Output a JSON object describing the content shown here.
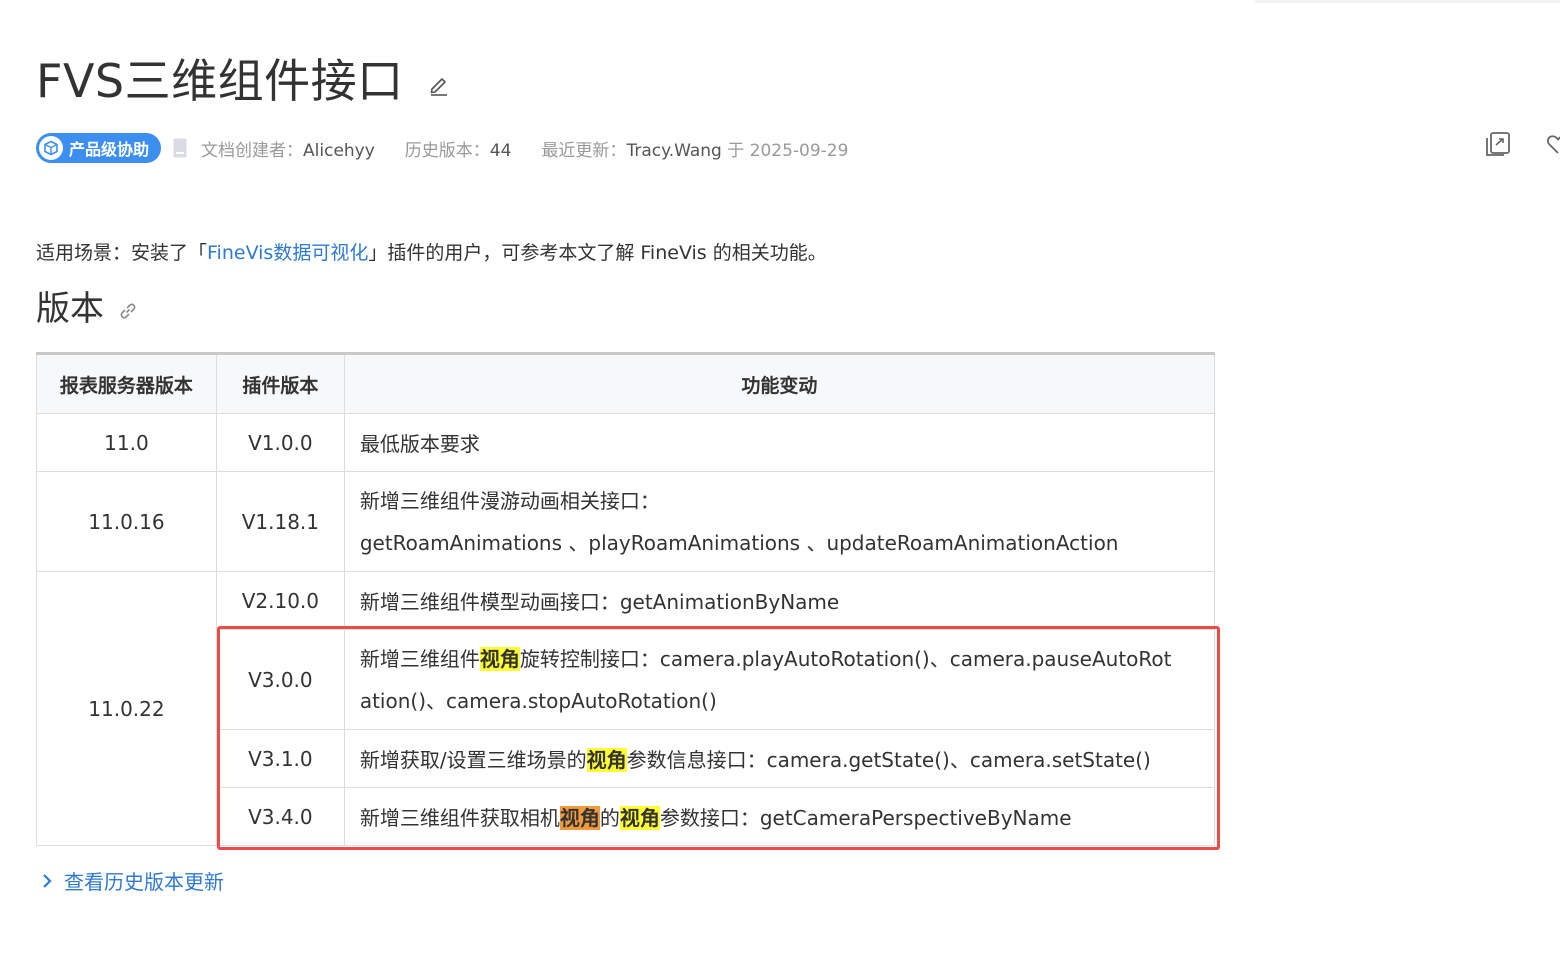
{
  "header": {
    "title": "FVS三维组件接口",
    "badge_label": "产品级协助",
    "creator_label": "文档创建者：",
    "creator_value": "Alicehyy",
    "history_label": "历史版本：",
    "history_value": "44",
    "updated_label": "最近更新：",
    "updated_user": "Tracy.Wang",
    "updated_on": " 于 2025-09-29"
  },
  "icons": {
    "edit": "pencil-icon",
    "badge": "cube-icon",
    "doc": "document-icon",
    "share": "copy-link-icon",
    "favorite": "heart-icon",
    "anchor": "link-icon",
    "history": "chevron-right-icon"
  },
  "intro": {
    "prefix": "适用场景：安装了「",
    "link": "FineVis数据可视化",
    "suffix": "」插件的用户，可参考本文了解 FineVis 的相关功能。"
  },
  "section": {
    "heading": "版本"
  },
  "table": {
    "headers": [
      "报表服务器版本",
      "插件版本",
      "功能变动"
    ],
    "rows": [
      {
        "server": "11.0",
        "plugin": "V1.0.0",
        "change": "最低版本要求"
      },
      {
        "server": "11.0.16",
        "plugin": "V1.18.1",
        "change_line1": "新增三维组件漫游动画相关接口：",
        "change_line2": "getRoamAnimations 、playRoamAnimations 、updateRoamAnimationAction"
      },
      {
        "server": "11.0.22",
        "plugin": "V2.10.0",
        "change": "新增三维组件模型动画接口：getAnimationByName"
      },
      {
        "plugin": "V3.0.0",
        "change_a": "新增三维组件",
        "hl": "视角",
        "change_b": "旋转控制接口：camera.playAutoRotation()、camera.pauseAutoRot",
        "change_c": "ation()、camera.stopAutoRotation()"
      },
      {
        "plugin": "V3.1.0",
        "change_a": "新增获取/设置三维场景的",
        "hl": "视角",
        "change_b": "参数信息接口：camera.getState()、camera.setState()"
      },
      {
        "plugin": "V3.4.0",
        "change_a": "新增三维组件获取相机",
        "hl1": "视角",
        "change_mid": "的",
        "hl2": "视角",
        "change_b": "参数接口：getCameraPerspectiveByName"
      }
    ]
  },
  "footer": {
    "history_link": "查看历史版本更新"
  },
  "colors": {
    "link": "#2f7ad1",
    "badge": "#3c8ef0",
    "highlight_yellow": "#ffff33",
    "highlight_orange": "#f29a3d",
    "annotation_box": "#ea4c4c"
  }
}
